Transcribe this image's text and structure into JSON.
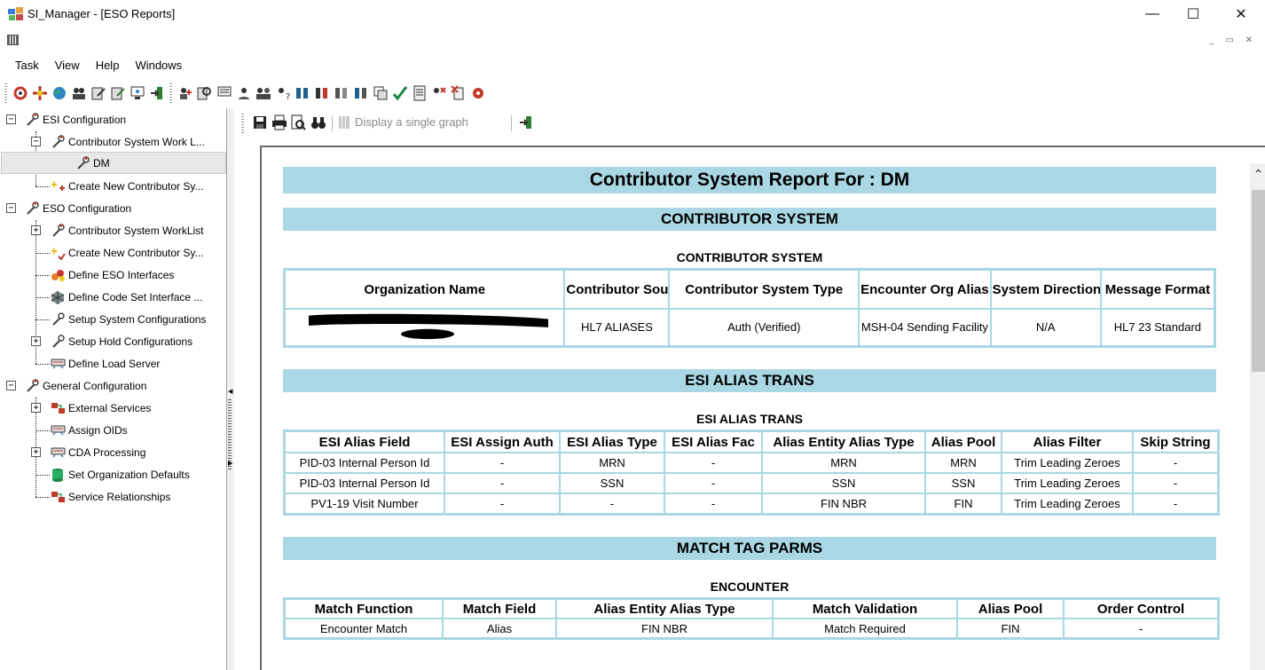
{
  "window": {
    "title": "SI_Manager - [ESO Reports]",
    "min_label": "—",
    "max_label": "☐",
    "close_label": "✕"
  },
  "mdi": {
    "controls": "_ ▭ ✕"
  },
  "menu": [
    "Task",
    "View",
    "Help",
    "Windows"
  ],
  "tree": [
    {
      "label": "ESI Configuration",
      "expander": "−"
    },
    {
      "label": "Contributor System Work L...",
      "expander": "−"
    },
    {
      "label": "DM"
    },
    {
      "label": "Create New Contributor Sy..."
    },
    {
      "label": "ESO Configuration",
      "expander": "−"
    },
    {
      "label": "Contributor System WorkList",
      "expander": "+"
    },
    {
      "label": "Create New Contributor Sy..."
    },
    {
      "label": "Define ESO Interfaces"
    },
    {
      "label": "Define Code Set Interface ..."
    },
    {
      "label": "Setup System Configurations"
    },
    {
      "label": "Setup Hold Configurations",
      "expander": "+"
    },
    {
      "label": "Define Load Server"
    },
    {
      "label": "General Configuration",
      "expander": "−"
    },
    {
      "label": "External Services",
      "expander": "+"
    },
    {
      "label": "Assign OIDs"
    },
    {
      "label": "CDA Processing",
      "expander": "+"
    },
    {
      "label": "Set Organization Defaults"
    },
    {
      "label": "Service Relationships"
    }
  ],
  "report_toolbar": {
    "graph_label": "Display a single graph"
  },
  "report": {
    "title": "Contributor System Report For : DM",
    "section1": "CONTRIBUTOR SYSTEM",
    "caption1": "CONTRIBUTOR SYSTEM",
    "table1": {
      "headers": [
        "Organization Name",
        "Contributor Source",
        "Contributor System Type",
        "Encounter Org Alias",
        "System Direction",
        "Message Format"
      ],
      "row": [
        "",
        "HL7 ALIASES",
        "Auth (Verified)",
        "MSH-04 Sending Facility",
        "N/A",
        "HL7 23 Standard"
      ]
    },
    "section2": "ESI ALIAS TRANS",
    "caption2": "ESI ALIAS TRANS",
    "table2": {
      "headers": [
        "ESI Alias Field",
        "ESI Assign Auth",
        "ESI Alias Type",
        "ESI Alias Fac",
        "Alias Entity Alias Type",
        "Alias Pool",
        "Alias Filter",
        "Skip String"
      ],
      "rows": [
        [
          "PID-03 Internal Person Id",
          "-",
          "MRN",
          "-",
          "MRN",
          "MRN",
          "Trim Leading Zeroes",
          "-"
        ],
        [
          "PID-03 Internal Person Id",
          "-",
          "SSN",
          "-",
          "SSN",
          "SSN",
          "Trim Leading Zeroes",
          "-"
        ],
        [
          "PV1-19 Visit Number",
          "-",
          "-",
          "-",
          "FIN NBR",
          "FIN",
          "Trim Leading Zeroes",
          "-"
        ]
      ]
    },
    "section3": "MATCH TAG PARMS",
    "caption3": "ENCOUNTER",
    "table3": {
      "headers": [
        "Match Function",
        "Match Field",
        "Alias Entity Alias Type",
        "Match Validation",
        "Alias Pool",
        "Order Control"
      ],
      "rows": [
        [
          "Encounter Match",
          "Alias",
          "FIN NBR",
          "Match Required",
          "FIN",
          "-"
        ]
      ]
    }
  }
}
